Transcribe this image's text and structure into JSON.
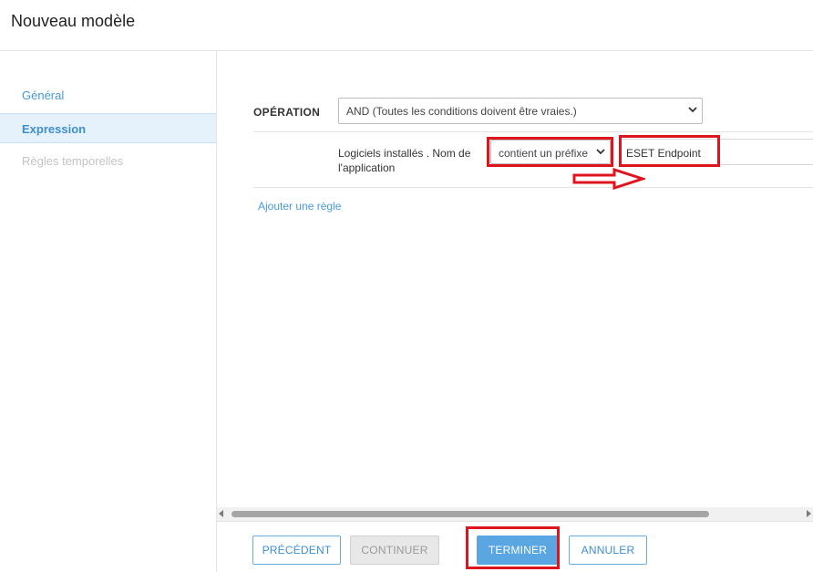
{
  "window": {
    "title": "Nouveau modèle"
  },
  "sidebar": {
    "items": [
      {
        "label": "Général",
        "state": "link"
      },
      {
        "label": "Expression",
        "state": "active"
      },
      {
        "label": "Règles temporelles",
        "state": "disabled"
      }
    ]
  },
  "operation": {
    "label": "OPÉRATION",
    "selected": "AND (Toutes les conditions doivent être vraies.)"
  },
  "rule": {
    "field_label": "Logiciels installés . Nom de l'application",
    "condition": "contient un préfixe",
    "value": "ESET Endpoint"
  },
  "add_rule": {
    "label": "Ajouter une règle"
  },
  "footer": {
    "prev_label": "PRÉCÉDENT",
    "continue_label": "CONTINUER",
    "finish_label": "TERMINER",
    "cancel_label": "ANNULER"
  },
  "icons": {
    "select_chevron": "chevron-down-icon",
    "annotation_arrow": "arrow-right-icon"
  },
  "colors": {
    "accent": "#4a9ad8",
    "primary_button": "#5aa6e2",
    "annotation": "#e0141e",
    "active_bg": "#e6f2fb"
  }
}
